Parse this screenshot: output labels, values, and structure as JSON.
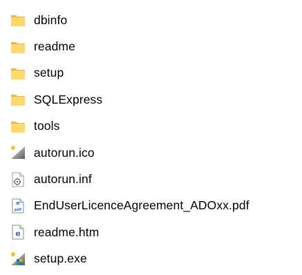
{
  "colors": {
    "folder_body": "#ffd86b",
    "folder_tab": "#e8b64a",
    "text": "#000000",
    "doc_blue": "#2a6fc9"
  },
  "files": [
    {
      "name": "dbinfo",
      "type": "folder",
      "icon": "folder-icon"
    },
    {
      "name": "readme",
      "type": "folder",
      "icon": "folder-icon"
    },
    {
      "name": "setup",
      "type": "folder",
      "icon": "folder-icon"
    },
    {
      "name": "SQLExpress",
      "type": "folder",
      "icon": "folder-icon"
    },
    {
      "name": "tools",
      "type": "folder",
      "icon": "folder-icon"
    },
    {
      "name": "autorun.ico",
      "type": "ico",
      "icon": "icon-file-icon"
    },
    {
      "name": "autorun.inf",
      "type": "inf",
      "icon": "settings-file-icon"
    },
    {
      "name": "EndUserLicenceAgreement_ADOxx.pdf",
      "type": "pdf",
      "icon": "pdf-file-icon"
    },
    {
      "name": "readme.htm",
      "type": "htm",
      "icon": "html-file-icon"
    },
    {
      "name": "setup.exe",
      "type": "exe",
      "icon": "exe-file-icon"
    }
  ],
  "pdf_badge": "pdf"
}
